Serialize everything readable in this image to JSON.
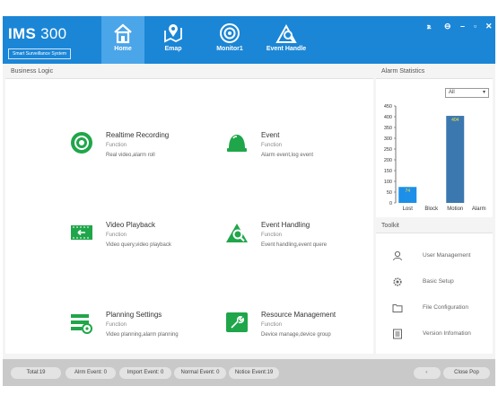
{
  "header": {
    "brand_title": "IMS",
    "brand_version": "300",
    "brand_subtitle": "Smart Surveillance System",
    "tabs": [
      {
        "label": "Home",
        "icon": "home-icon",
        "active": true
      },
      {
        "label": "Emap",
        "icon": "map-pin-icon",
        "active": false
      },
      {
        "label": "Monitor1",
        "icon": "camera-icon",
        "active": false
      },
      {
        "label": "Event Handle",
        "icon": "event-search-icon",
        "active": false
      }
    ],
    "window_controls": [
      "user-icon",
      "lock-icon",
      "minimize-icon",
      "maximize-icon",
      "close-icon"
    ],
    "window_glyphs": {
      "user": "ꭱ",
      "lock": "⊖",
      "minimize": "–",
      "maximize": "▫",
      "close": "✕"
    },
    "accent": "#1b86d6",
    "active_tab_color": "#4aa5e9"
  },
  "main": {
    "title": "Business Logic",
    "features": [
      {
        "title": "Realtime Recording",
        "subtitle": "Function",
        "desc": "Real video,alarm roll",
        "icon": "recording-icon"
      },
      {
        "title": "Event",
        "subtitle": "Function",
        "desc": "Alarm event,log event",
        "icon": "bell-icon"
      },
      {
        "title": "Video Playback",
        "subtitle": "Function",
        "desc": "Video query,video playback",
        "icon": "playback-icon"
      },
      {
        "title": "Event Handling",
        "subtitle": "Function",
        "desc": "Event handling,event quere",
        "icon": "event-handling-icon"
      },
      {
        "title": "Planning Settings",
        "subtitle": "Function",
        "desc": "Video planning,alarm planning",
        "icon": "planning-icon"
      },
      {
        "title": "Resource Management",
        "subtitle": "Function",
        "desc": "Device manage,device group",
        "icon": "resource-icon"
      }
    ],
    "icon_color": "#1fa64a"
  },
  "alarm_stats": {
    "title": "Alarm Statistics",
    "filter_value": "All"
  },
  "chart_data": {
    "type": "bar",
    "categories": [
      "Lost",
      "Block",
      "Motion",
      "Alarm"
    ],
    "values": [
      74,
      0,
      404,
      0
    ],
    "value_labels": [
      "74",
      "",
      "404",
      ""
    ],
    "ylim": [
      0,
      450
    ],
    "yticks": [
      0,
      50,
      100,
      150,
      200,
      250,
      300,
      350,
      400,
      450
    ],
    "colors": [
      "#1d8fe8",
      "#1d8fe8",
      "#3c78b0",
      "#1d8fe8"
    ],
    "label_color": "#f2e23a",
    "grid": false
  },
  "toolkit": {
    "title": "Toolkit",
    "items": [
      {
        "label": "User Management",
        "icon": "user-icon"
      },
      {
        "label": "Basic Setup",
        "icon": "gear-icon"
      },
      {
        "label": "File Configuration",
        "icon": "folder-icon"
      },
      {
        "label": "Version Infomation",
        "icon": "info-icon"
      }
    ]
  },
  "footer": {
    "total": "Total:19",
    "alarm_event": "Alrm Event: 0",
    "import_event": "Import Event: 0",
    "normal_event": "Normal Event: 0",
    "notice_event": "Notice Event:19",
    "close_pop": "Close Pop"
  }
}
